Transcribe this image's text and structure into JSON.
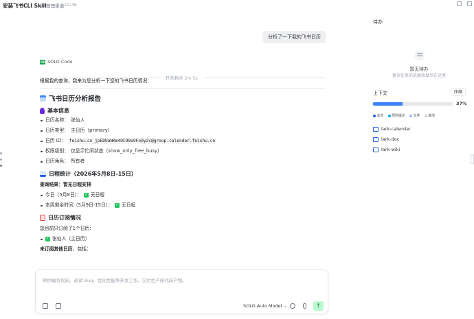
{
  "header": {
    "title": "安装飞书CLI Skill",
    "folder": "管理渠道",
    "time": "· 22:46"
  },
  "chat": {
    "user_message": "分析了一下我的飞书日历",
    "agent": "SOLO Code",
    "elapsed": "任务耗时 2m 5s",
    "intro": "根据我的查询，我来为您分析一下您的飞书日历情况:",
    "report_title": "飞书日历分析报告",
    "basic": {
      "heading": "基本信息",
      "items": [
        {
          "label": "日历名称：",
          "value": "张仙人"
        },
        {
          "label": "日历类型：",
          "value": "主日历（primary）"
        },
        {
          "label": "日历 ID：",
          "value": "feishu.cn_jpEDUaNKm4UC98x9FoOy2c@group.calendar.feishu.cn"
        },
        {
          "label": "权限级别：",
          "value": "仅显示忙闲状态（show_only_free_busy）"
        },
        {
          "label": "日历角色：",
          "value": "所有者"
        }
      ]
    },
    "stats": {
      "heading": "日程统计（2026年5月8日-15日）",
      "result": "查询结果：暂无日程安排",
      "items": [
        {
          "label": "今日（5月8日）：",
          "value": "无日程"
        },
        {
          "label": "本周剩余时间（5月9日-15日）：",
          "value": "无日程"
        }
      ]
    },
    "subs": {
      "heading": "日历订阅情况",
      "line": "您目前只订阅了1个日历:",
      "items": [
        {
          "value": "张仙人（主日历）"
        }
      ],
      "unsub": "未订阅其他日历",
      "unsub_rest": "，包括："
    }
  },
  "input": {
    "placeholder": "帮你编写代码、调试 Bug、优化性能等开发工作，交付生产级代码产物。",
    "model": "SOLO Auto Model ⌄"
  },
  "sidebar": {
    "todo_title": "待办",
    "todo_empty": "暂无待办",
    "todo_sub": "复杂任务的进展会显示在这里",
    "ctx_title": "上下文",
    "ctx_btn": "压缩",
    "progress": 0.37,
    "progress_text": "37%",
    "legend": [
      {
        "label": "总览",
        "color": "#2563eb"
      },
      {
        "label": "规则提示",
        "color": "#0ea5e9"
      },
      {
        "label": "文件",
        "color": "#a5b4fc"
      },
      {
        "label": "其他",
        "color": "#cbd5e1"
      }
    ],
    "skills": [
      "lark-calendar",
      "lark-doc",
      "lark-wiki"
    ]
  }
}
